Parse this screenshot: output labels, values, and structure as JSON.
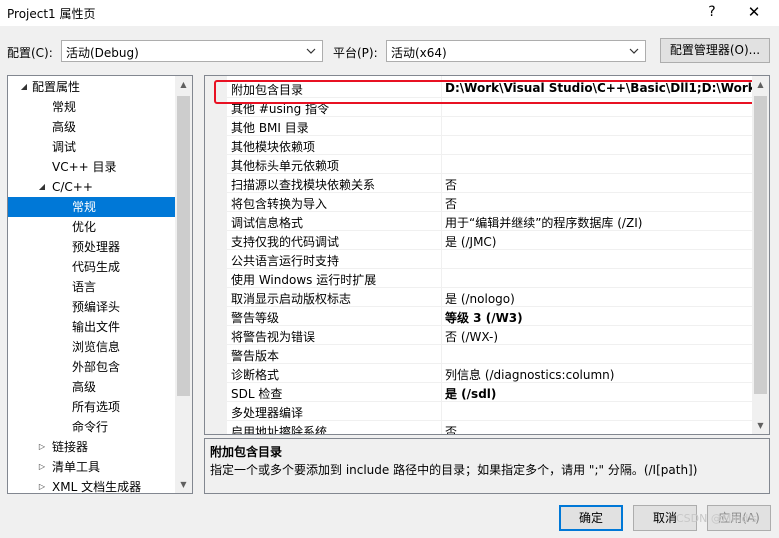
{
  "window": {
    "title": "Project1 属性页",
    "help_glyph": "?",
    "close_glyph": "✕"
  },
  "config": {
    "label": "配置(C):",
    "value": "活动(Debug)"
  },
  "platform": {
    "label": "平台(P):",
    "value": "活动(x64)"
  },
  "config_manager_label": "配置管理器(O)...",
  "tree": {
    "items": [
      {
        "label": "配置属性",
        "toggle": "◢"
      },
      {
        "label": "常规",
        "toggle": ""
      },
      {
        "label": "高级",
        "toggle": ""
      },
      {
        "label": "调试",
        "toggle": ""
      },
      {
        "label": "VC++ 目录",
        "toggle": ""
      },
      {
        "label": "C/C++",
        "toggle": "◢"
      },
      {
        "label": "常规",
        "toggle": ""
      },
      {
        "label": "优化",
        "toggle": ""
      },
      {
        "label": "预处理器",
        "toggle": ""
      },
      {
        "label": "代码生成",
        "toggle": ""
      },
      {
        "label": "语言",
        "toggle": ""
      },
      {
        "label": "预编译头",
        "toggle": ""
      },
      {
        "label": "输出文件",
        "toggle": ""
      },
      {
        "label": "浏览信息",
        "toggle": ""
      },
      {
        "label": "外部包含",
        "toggle": ""
      },
      {
        "label": "高级",
        "toggle": ""
      },
      {
        "label": "所有选项",
        "toggle": ""
      },
      {
        "label": "命令行",
        "toggle": ""
      },
      {
        "label": "链接器",
        "toggle": "▷"
      },
      {
        "label": "清单工具",
        "toggle": "▷"
      },
      {
        "label": "XML 文档生成器",
        "toggle": "▷"
      }
    ]
  },
  "properties": [
    {
      "name": "附加包含目录",
      "value": "D:\\Work\\Visual Studio\\C++\\Basic\\Dll1;D:\\Work\\Visual Studio\\C++\\Basic",
      "bold": true
    },
    {
      "name": "其他 #using 指令",
      "value": "",
      "bold": false
    },
    {
      "name": "其他 BMI 目录",
      "value": "",
      "bold": false
    },
    {
      "name": "其他模块依赖项",
      "value": "",
      "bold": false
    },
    {
      "name": "其他标头单元依赖项",
      "value": "",
      "bold": false
    },
    {
      "name": "扫描源以查找模块依赖关系",
      "value": "否",
      "bold": false
    },
    {
      "name": "将包含转换为导入",
      "value": "否",
      "bold": false
    },
    {
      "name": "调试信息格式",
      "value": "用于“编辑并继续”的程序数据库 (/ZI)",
      "bold": false
    },
    {
      "name": "支持仅我的代码调试",
      "value": "是 (/JMC)",
      "bold": false
    },
    {
      "name": "公共语言运行时支持",
      "value": "",
      "bold": false
    },
    {
      "name": "使用 Windows 运行时扩展",
      "value": "",
      "bold": false
    },
    {
      "name": "取消显示启动版权标志",
      "value": "是 (/nologo)",
      "bold": false
    },
    {
      "name": "警告等级",
      "value": "等级 3 (/W3)",
      "bold": true
    },
    {
      "name": "将警告视为错误",
      "value": "否 (/WX-)",
      "bold": false
    },
    {
      "name": "警告版本",
      "value": "",
      "bold": false
    },
    {
      "name": "诊断格式",
      "value": "列信息 (/diagnostics:column)",
      "bold": false
    },
    {
      "name": "SDL 检查",
      "value": "是 (/sdl)",
      "bold": true
    },
    {
      "name": "多处理器编译",
      "value": "",
      "bold": false
    },
    {
      "name": "启用地址擦除系统",
      "value": "否",
      "bold": false
    }
  ],
  "description": {
    "title": "附加包含目录",
    "text": "指定一个或多个要添加到 include 路径中的目录；如果指定多个，请用 \";\" 分隔。(/I[path])"
  },
  "buttons": {
    "ok": "确定",
    "cancel": "取消",
    "apply": "应用(A)"
  },
  "watermark": "CSDN @Mind's"
}
